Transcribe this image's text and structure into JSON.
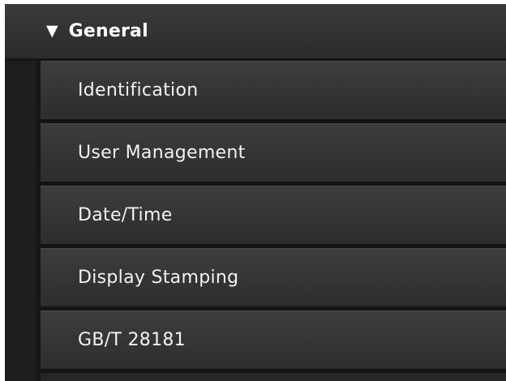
{
  "menu": {
    "section": {
      "label": "General",
      "caret_glyph": "▼",
      "expanded": true
    },
    "items": [
      {
        "label": "Identification"
      },
      {
        "label": "User Management"
      },
      {
        "label": "Date/Time"
      },
      {
        "label": "Display Stamping"
      },
      {
        "label": "GB/T 28181"
      }
    ]
  },
  "colors": {
    "background": "#262626",
    "text": "#f2f2f2"
  }
}
